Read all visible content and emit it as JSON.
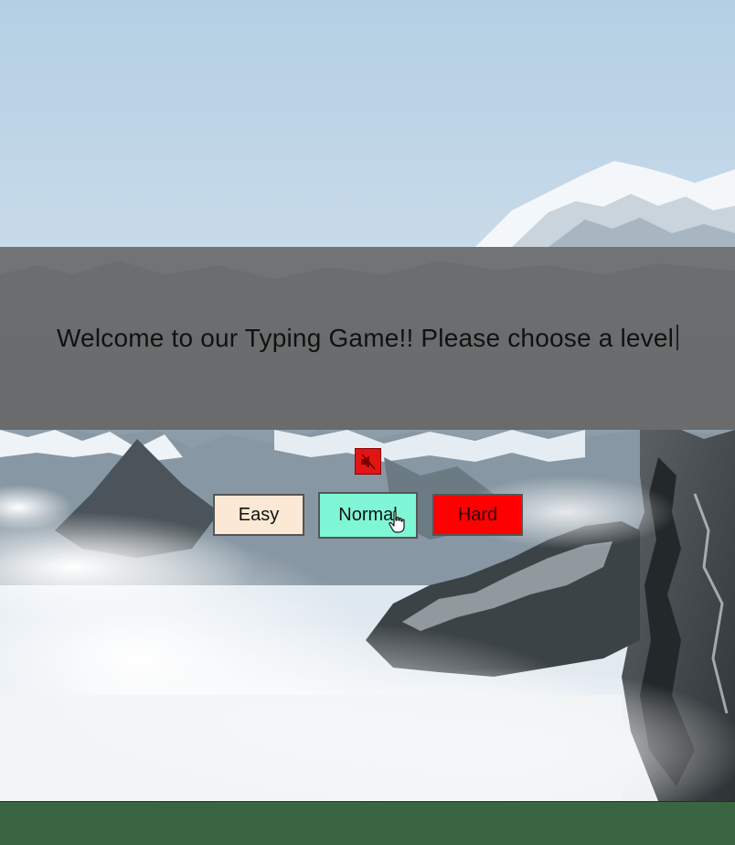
{
  "banner": {
    "message": "Welcome to our Typing Game!! Please choose a level"
  },
  "controls": {
    "mute_icon": "speaker-muted-icon"
  },
  "levels": [
    {
      "label": "Easy"
    },
    {
      "label": "Normal"
    },
    {
      "label": "Hard"
    }
  ],
  "colors": {
    "easy": "#fbe9d5",
    "normal": "#7ff7d6",
    "hard": "#ff0000",
    "mute": "#e41414",
    "banner_overlay": "#646464",
    "footer": "#3b6540"
  },
  "background": {
    "scene": "snowy-mountains-above-clouds"
  }
}
